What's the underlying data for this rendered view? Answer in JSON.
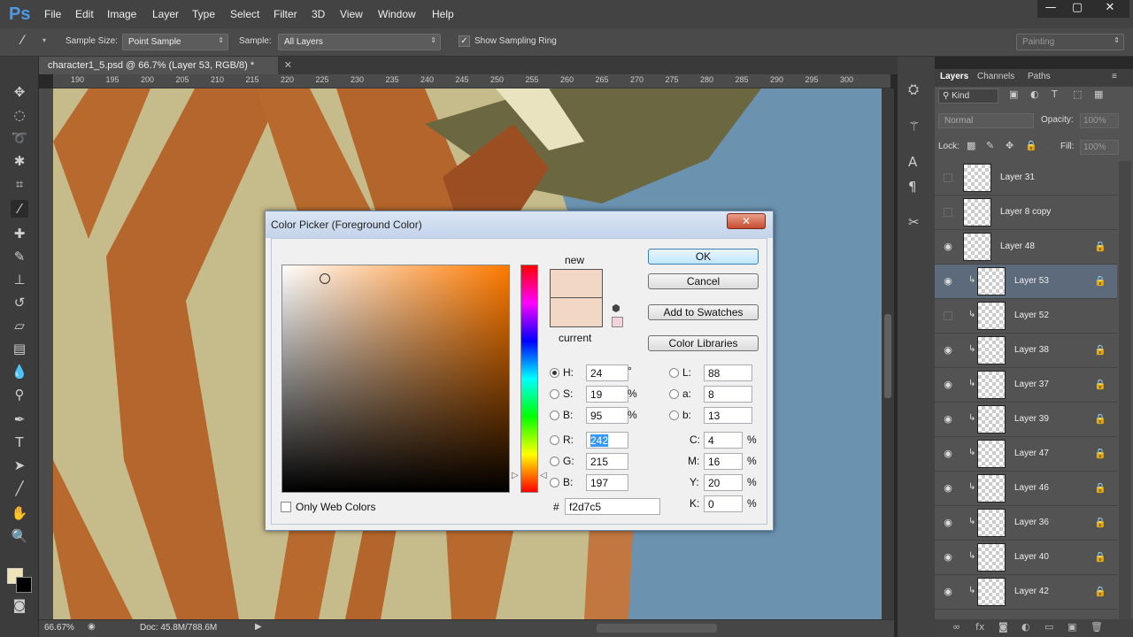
{
  "app": {
    "logo": "Ps"
  },
  "menu": [
    "File",
    "Edit",
    "Image",
    "Layer",
    "Type",
    "Select",
    "Filter",
    "3D",
    "View",
    "Window",
    "Help"
  ],
  "window_controls": {
    "minimize": "—",
    "maximize": "▢",
    "close": "✕"
  },
  "options_bar": {
    "sample_size_label": "Sample Size:",
    "sample_size_value": "Point Sample",
    "sample_label": "Sample:",
    "sample_value": "All Layers",
    "show_ring_label": "Show Sampling Ring",
    "show_ring_checked": true,
    "workspace": "Painting"
  },
  "document": {
    "tab_title": "character1_5.psd @ 66.7% (Layer 53, RGB/8) *",
    "zoom": "66.67%",
    "doc_size": "Doc: 45.8M/788.6M",
    "ruler_ticks": [
      "190",
      "195",
      "200",
      "205",
      "210",
      "215",
      "220",
      "225",
      "230",
      "235",
      "240",
      "245",
      "250",
      "255",
      "260",
      "265",
      "270",
      "275",
      "280",
      "285",
      "290",
      "295",
      "300"
    ]
  },
  "color_picker": {
    "title": "Color Picker (Foreground Color)",
    "close": "✕",
    "new_label": "new",
    "current_label": "current",
    "new_color": "#f2d7c5",
    "current_color": "#f2d7c5",
    "buttons": {
      "ok": "OK",
      "cancel": "Cancel",
      "add_swatches": "Add to Swatches",
      "color_libraries": "Color Libraries"
    },
    "hsb": {
      "h_label": "H:",
      "h": "24",
      "h_unit": "°",
      "s_label": "S:",
      "s": "19",
      "s_unit": "%",
      "b_label": "B:",
      "b": "95",
      "b_unit": "%"
    },
    "rgb": {
      "r_label": "R:",
      "r": "242",
      "g_label": "G:",
      "g": "215",
      "b_label": "B:",
      "b": "197"
    },
    "lab": {
      "l_label": "L:",
      "l": "88",
      "a_label": "a:",
      "a": "8",
      "b_label": "b:",
      "b": "13"
    },
    "cmyk": {
      "c_label": "C:",
      "c": "4",
      "m_label": "M:",
      "m": "16",
      "y_label": "Y:",
      "y": "20",
      "k_label": "K:",
      "k": "0",
      "unit": "%"
    },
    "hex_label": "#",
    "hex": "f2d7c5",
    "only_web_colors": "Only Web Colors"
  },
  "layers_panel": {
    "tabs": [
      "Layers",
      "Channels",
      "Paths"
    ],
    "kind": "Kind",
    "blend_mode": "Normal",
    "opacity_label": "Opacity:",
    "opacity": "100%",
    "lock_label": "Lock:",
    "fill_label": "Fill:",
    "fill": "100%",
    "layers": [
      {
        "name": "Layer 31",
        "visible": false,
        "clipped": false,
        "locked": false,
        "selected": false
      },
      {
        "name": "Layer 8 copy",
        "visible": false,
        "clipped": false,
        "locked": false,
        "selected": false
      },
      {
        "name": "Layer 48",
        "visible": true,
        "clipped": false,
        "locked": true,
        "selected": false
      },
      {
        "name": "Layer 53",
        "visible": true,
        "clipped": true,
        "locked": true,
        "selected": true
      },
      {
        "name": "Layer 52",
        "visible": false,
        "clipped": true,
        "locked": false,
        "selected": false
      },
      {
        "name": "Layer 38",
        "visible": true,
        "clipped": true,
        "locked": true,
        "selected": false
      },
      {
        "name": "Layer 37",
        "visible": true,
        "clipped": true,
        "locked": true,
        "selected": false
      },
      {
        "name": "Layer 39",
        "visible": true,
        "clipped": true,
        "locked": true,
        "selected": false
      },
      {
        "name": "Layer 47",
        "visible": true,
        "clipped": true,
        "locked": true,
        "selected": false
      },
      {
        "name": "Layer 46",
        "visible": true,
        "clipped": true,
        "locked": true,
        "selected": false
      },
      {
        "name": "Layer 36",
        "visible": true,
        "clipped": true,
        "locked": true,
        "selected": false
      },
      {
        "name": "Layer 40",
        "visible": true,
        "clipped": true,
        "locked": true,
        "selected": false
      },
      {
        "name": "Layer 42",
        "visible": true,
        "clipped": true,
        "locked": true,
        "selected": false
      }
    ]
  }
}
